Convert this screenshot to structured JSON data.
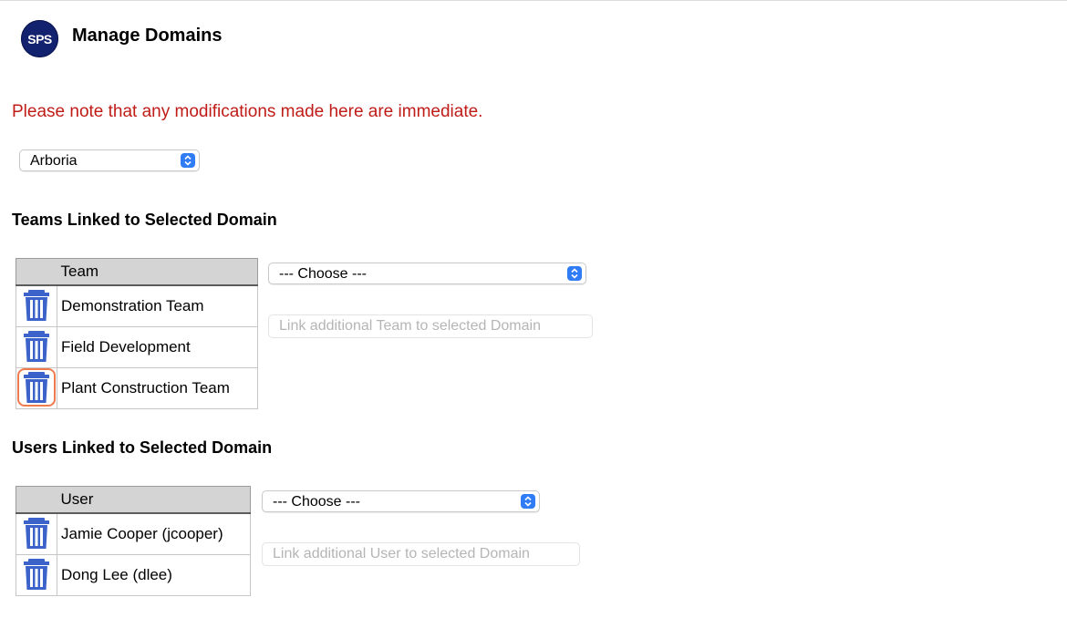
{
  "header": {
    "logo_text": "SPS",
    "title": "Manage Domains"
  },
  "notice": "Please note that any modifications made here are immediate.",
  "domain_select": {
    "value": "Arboria"
  },
  "teams": {
    "section_title": "Teams Linked to Selected Domain",
    "column_header": "Team",
    "rows": [
      {
        "name": "Demonstration Team"
      },
      {
        "name": "Field Development"
      },
      {
        "name": "Plant Construction Team"
      }
    ],
    "choose_select": {
      "value": "--- Choose ---"
    },
    "link_button": "Link additional Team to selected Domain"
  },
  "users": {
    "section_title": "Users Linked to Selected Domain",
    "column_header": "User",
    "rows": [
      {
        "name": "Jamie Cooper (jcooper)"
      },
      {
        "name": "Dong Lee (dlee)"
      }
    ],
    "choose_select": {
      "value": "--- Choose ---"
    },
    "link_button": "Link additional User to selected Domain"
  },
  "colors": {
    "notice": "#c01c17",
    "logo": "#13226e",
    "trash": "#3b63c9",
    "focus_ring": "#ef7a4c",
    "select_accent": "#2f7cf6"
  },
  "icons": {
    "trash": "trash-icon",
    "select": "chevron-updown-icon"
  }
}
